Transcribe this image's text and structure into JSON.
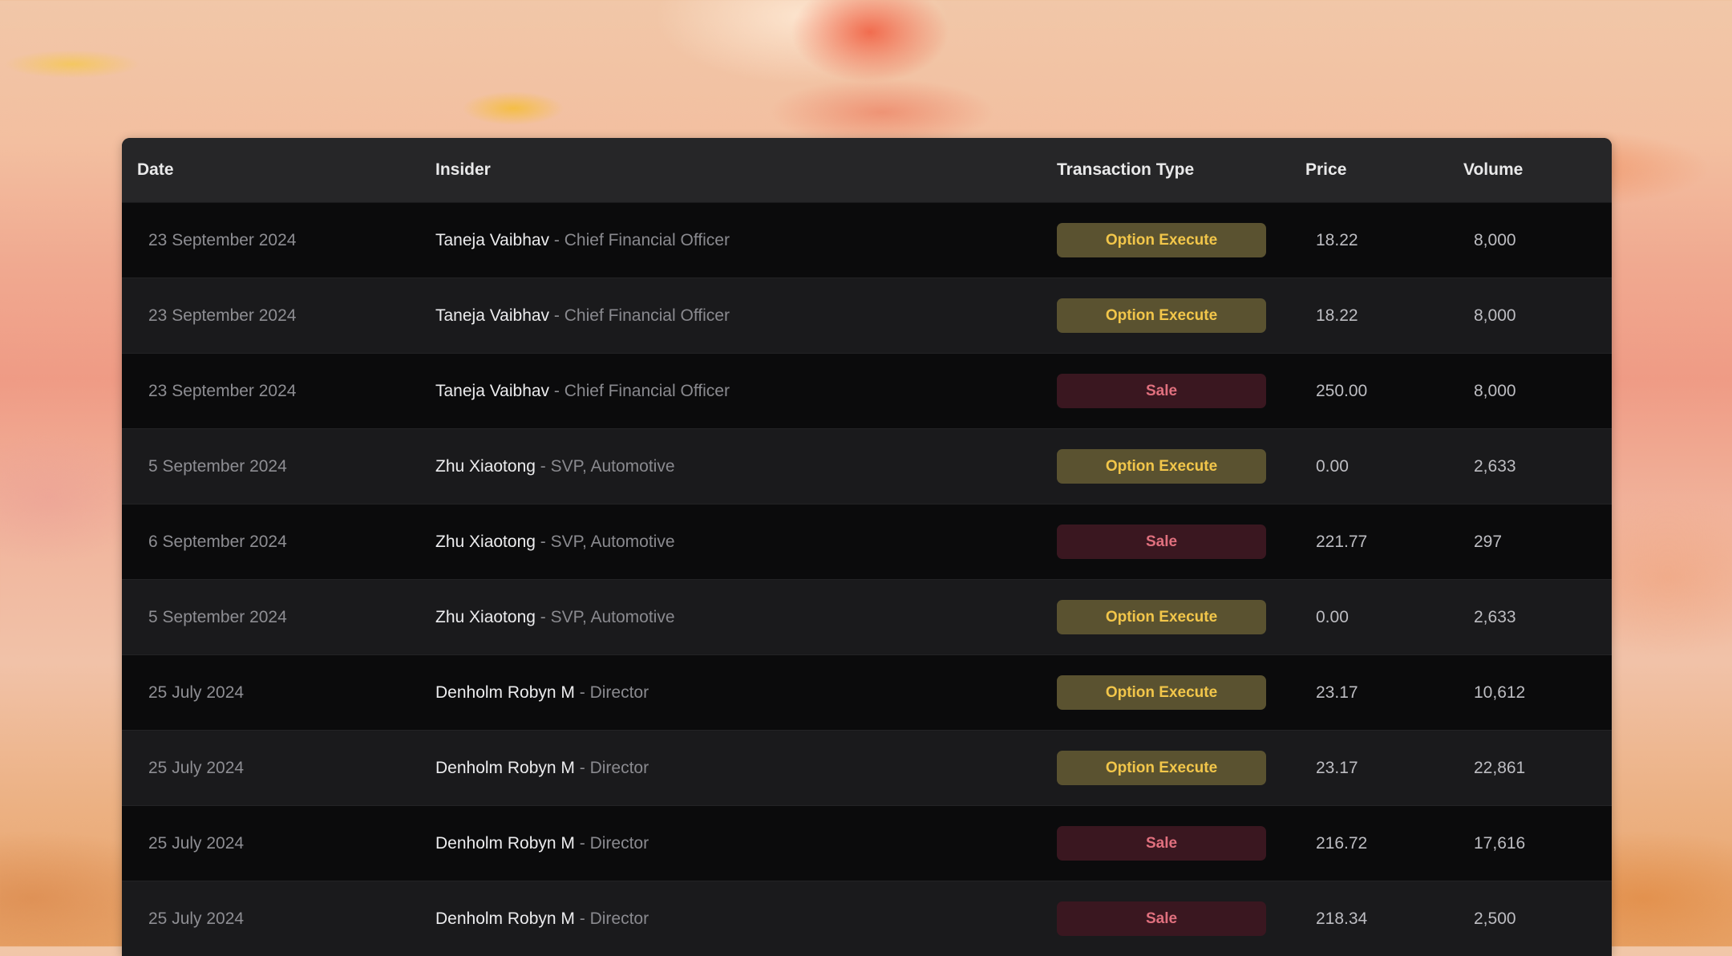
{
  "table": {
    "columns": [
      "Date",
      "Insider",
      "Transaction Type",
      "Price",
      "Volume"
    ],
    "separator": "-",
    "rows": [
      {
        "date": "23 September 2024",
        "name": "Taneja Vaibhav",
        "role": "Chief Financial Officer",
        "type": "Option Execute",
        "kind": "opt",
        "price": "18.22",
        "volume": "8,000"
      },
      {
        "date": "23 September 2024",
        "name": "Taneja Vaibhav",
        "role": "Chief Financial Officer",
        "type": "Option Execute",
        "kind": "opt",
        "price": "18.22",
        "volume": "8,000"
      },
      {
        "date": "23 September 2024",
        "name": "Taneja Vaibhav",
        "role": "Chief Financial Officer",
        "type": "Sale",
        "kind": "sale",
        "price": "250.00",
        "volume": "8,000"
      },
      {
        "date": "5 September 2024",
        "name": "Zhu Xiaotong",
        "role": "SVP, Automotive",
        "type": "Option Execute",
        "kind": "opt",
        "price": "0.00",
        "volume": "2,633"
      },
      {
        "date": "6 September 2024",
        "name": "Zhu Xiaotong",
        "role": "SVP, Automotive",
        "type": "Sale",
        "kind": "sale",
        "price": "221.77",
        "volume": "297"
      },
      {
        "date": "5 September 2024",
        "name": "Zhu Xiaotong",
        "role": "SVP, Automotive",
        "type": "Option Execute",
        "kind": "opt",
        "price": "0.00",
        "volume": "2,633"
      },
      {
        "date": "25 July 2024",
        "name": "Denholm Robyn M",
        "role": "Director",
        "type": "Option Execute",
        "kind": "opt",
        "price": "23.17",
        "volume": "10,612"
      },
      {
        "date": "25 July 2024",
        "name": "Denholm Robyn M",
        "role": "Director",
        "type": "Option Execute",
        "kind": "opt",
        "price": "23.17",
        "volume": "22,861"
      },
      {
        "date": "25 July 2024",
        "name": "Denholm Robyn M",
        "role": "Director",
        "type": "Sale",
        "kind": "sale",
        "price": "216.72",
        "volume": "17,616"
      },
      {
        "date": "25 July 2024",
        "name": "Denholm Robyn M",
        "role": "Director",
        "type": "Sale",
        "kind": "sale",
        "price": "218.34",
        "volume": "2,500"
      }
    ]
  },
  "colors": {
    "option_badge_bg": "#5a5230",
    "option_badge_text": "#f2c64a",
    "sale_badge_bg": "#3a1720",
    "sale_badge_text": "#e0707e"
  }
}
